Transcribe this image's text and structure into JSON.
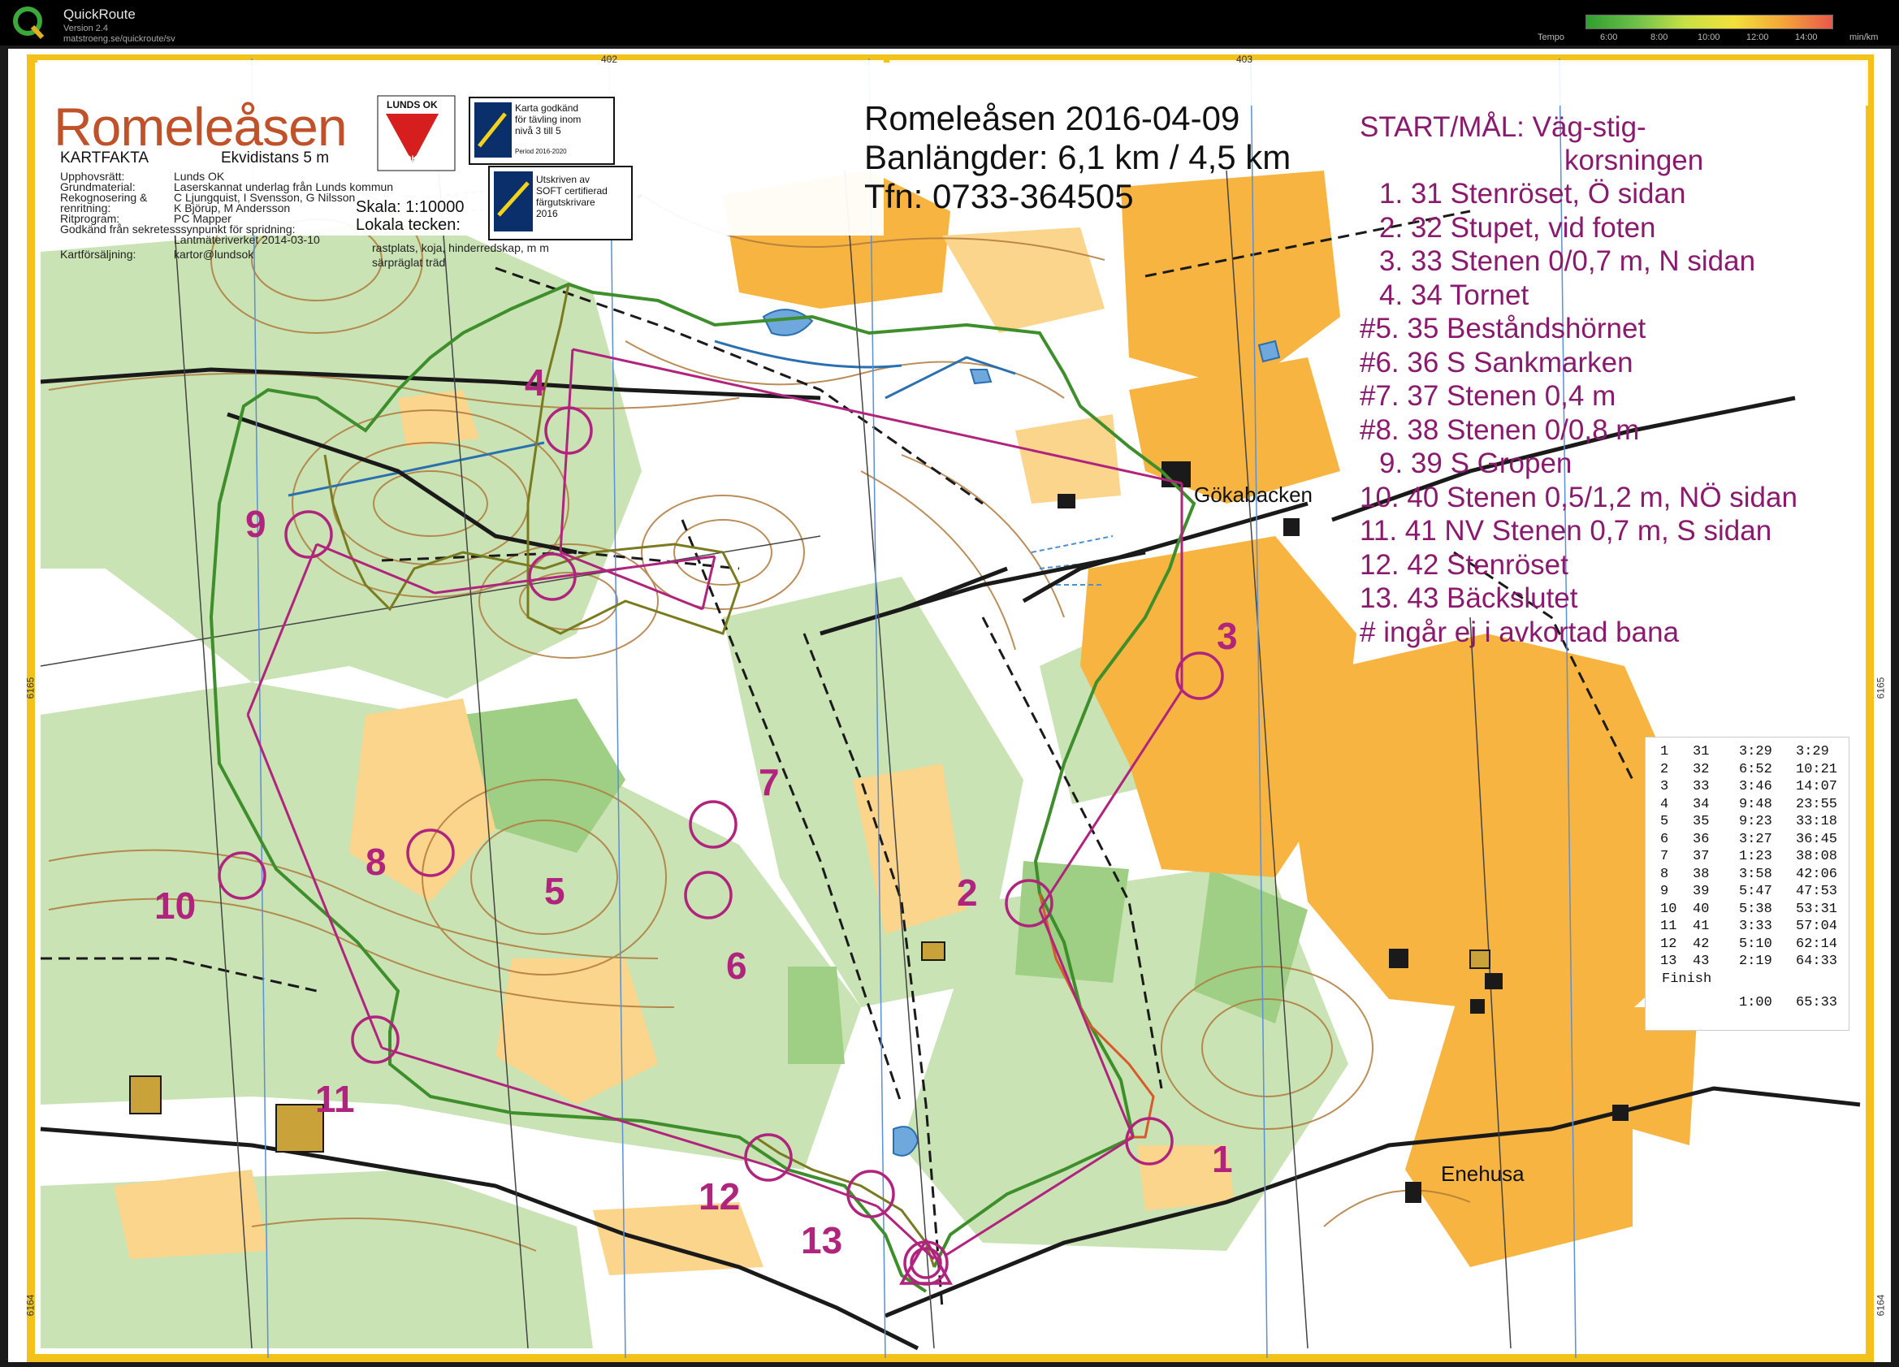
{
  "app": {
    "title": "QuickRoute",
    "version": "Version 2.4",
    "url": "matstroeng.se/quickroute/sv"
  },
  "pace_legend": {
    "label": "Tempo",
    "ticks": [
      "6:00",
      "8:00",
      "10:00",
      "12:00",
      "14:00"
    ],
    "unit": "min/km"
  },
  "map": {
    "name": "Romeleåsen",
    "club": "LUNDS OK",
    "club_short": "OK",
    "facts_header": "KARTFAKTA",
    "contour": "Ekvidistans 5 m",
    "facts_labels": [
      "Upphovsrätt:",
      "Grundmaterial:",
      "Rekognosering &",
      "renritning:",
      "Ritprogram:",
      "Godkänd från sekretesssynpunkt för spridning:",
      "",
      "Kartförsäljning:"
    ],
    "facts_values": [
      "Lunds OK",
      "Laserskannat underlag från Lunds kommun",
      "C Ljungquist, I Svensson, G Nilsson",
      "K Björup, M Andersson",
      "PC Mapper",
      "",
      "Lantmäteriverket 2014-03-10",
      "kartor@lundsok"
    ],
    "scale": "Skala: 1:10000",
    "local_header": "Lokala tecken:",
    "local_items": [
      "rastplats, koja, hinderredskap, m m",
      "särpräglat träd"
    ],
    "approved_text": [
      "Karta godkänd",
      "för tävling inom",
      "nivå 3 till 5",
      "Period 2016-2020"
    ],
    "printed_text": [
      "Utskriven av",
      "SOFT certifierad",
      "färgutskrivare",
      "2016"
    ],
    "info_lines": [
      "Romeleåsen 2016-04-09",
      "Banlängder: 6,1 km / 4,5 km",
      "Tfn: 0733-364505"
    ],
    "start_lines": [
      "START/MÅL: Väg-stig-",
      "korsningen"
    ],
    "controls_desc": [
      " 1. 31 Stenröset, Ö sidan",
      " 2. 32 Stupet, vid foten",
      " 3. 33 Stenen 0/0,7 m, N sidan",
      " 4. 34 Tornet",
      "#5. 35 Beståndshörnet",
      "#6. 36 S Sankmarken",
      "#7. 37 Stenen 0,4 m",
      "#8. 38 Stenen 0/0,8 m",
      " 9. 39 S Gropen",
      "10. 40 Stenen 0,5/1,2 m, NÖ sidan",
      "11. 41 NV Stenen 0,7 m, S sidan",
      "12. 42 Stenröset",
      "13. 43 Bäckslutet",
      "# ingår ej i avkortad bana"
    ],
    "place_names": [
      "Gökabacken",
      "Enehusa"
    ],
    "grid_labels": [
      "402",
      "403",
      "6165",
      "6164"
    ],
    "control_numbers": [
      "1",
      "2",
      "3",
      "4",
      "5",
      "6",
      "7",
      "8",
      "9",
      "10",
      "11",
      "12",
      "13"
    ]
  },
  "splits": [
    [
      "1",
      "31",
      "3:29",
      "3:29"
    ],
    [
      "2",
      "32",
      "6:52",
      "10:21"
    ],
    [
      "3",
      "33",
      "3:46",
      "14:07"
    ],
    [
      "4",
      "34",
      "9:48",
      "23:55"
    ],
    [
      "5",
      "35",
      "9:23",
      "33:18"
    ],
    [
      "6",
      "36",
      "3:27",
      "36:45"
    ],
    [
      "7",
      "37",
      "1:23",
      "38:08"
    ],
    [
      "8",
      "38",
      "3:58",
      "42:06"
    ],
    [
      "9",
      "39",
      "5:47",
      "47:53"
    ],
    [
      "10",
      "40",
      "5:38",
      "53:31"
    ],
    [
      "11",
      "41",
      "3:33",
      "57:04"
    ],
    [
      "12",
      "42",
      "5:10",
      "62:14"
    ],
    [
      "13",
      "43",
      "2:19",
      "64:33"
    ]
  ],
  "splits_finish": {
    "label": "Finish",
    "leg": "1:00",
    "total": "65:33"
  }
}
